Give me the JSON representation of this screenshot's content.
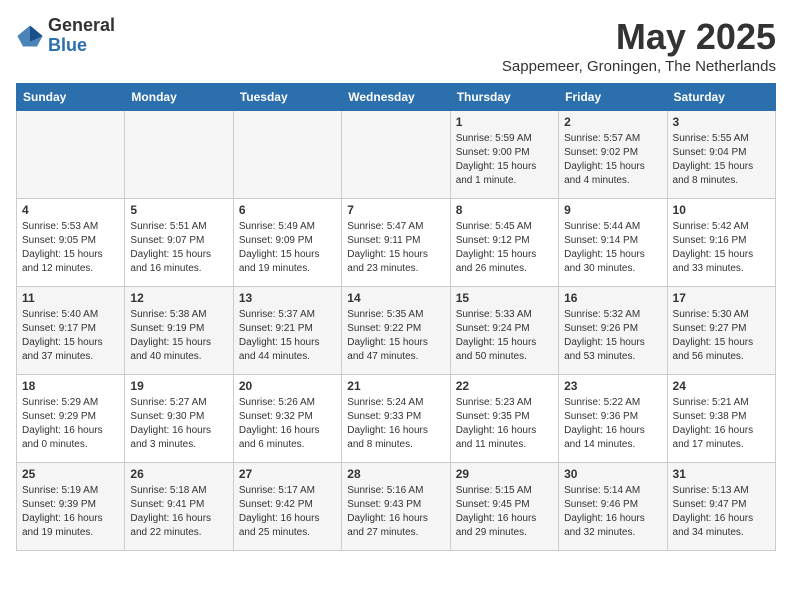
{
  "logo": {
    "general": "General",
    "blue": "Blue"
  },
  "title": "May 2025",
  "subtitle": "Sappemeer, Groningen, The Netherlands",
  "days_of_week": [
    "Sunday",
    "Monday",
    "Tuesday",
    "Wednesday",
    "Thursday",
    "Friday",
    "Saturday"
  ],
  "weeks": [
    [
      {
        "day": "",
        "info": ""
      },
      {
        "day": "",
        "info": ""
      },
      {
        "day": "",
        "info": ""
      },
      {
        "day": "",
        "info": ""
      },
      {
        "day": "1",
        "info": "Sunrise: 5:59 AM\nSunset: 9:00 PM\nDaylight: 15 hours\nand 1 minute."
      },
      {
        "day": "2",
        "info": "Sunrise: 5:57 AM\nSunset: 9:02 PM\nDaylight: 15 hours\nand 4 minutes."
      },
      {
        "day": "3",
        "info": "Sunrise: 5:55 AM\nSunset: 9:04 PM\nDaylight: 15 hours\nand 8 minutes."
      }
    ],
    [
      {
        "day": "4",
        "info": "Sunrise: 5:53 AM\nSunset: 9:05 PM\nDaylight: 15 hours\nand 12 minutes."
      },
      {
        "day": "5",
        "info": "Sunrise: 5:51 AM\nSunset: 9:07 PM\nDaylight: 15 hours\nand 16 minutes."
      },
      {
        "day": "6",
        "info": "Sunrise: 5:49 AM\nSunset: 9:09 PM\nDaylight: 15 hours\nand 19 minutes."
      },
      {
        "day": "7",
        "info": "Sunrise: 5:47 AM\nSunset: 9:11 PM\nDaylight: 15 hours\nand 23 minutes."
      },
      {
        "day": "8",
        "info": "Sunrise: 5:45 AM\nSunset: 9:12 PM\nDaylight: 15 hours\nand 26 minutes."
      },
      {
        "day": "9",
        "info": "Sunrise: 5:44 AM\nSunset: 9:14 PM\nDaylight: 15 hours\nand 30 minutes."
      },
      {
        "day": "10",
        "info": "Sunrise: 5:42 AM\nSunset: 9:16 PM\nDaylight: 15 hours\nand 33 minutes."
      }
    ],
    [
      {
        "day": "11",
        "info": "Sunrise: 5:40 AM\nSunset: 9:17 PM\nDaylight: 15 hours\nand 37 minutes."
      },
      {
        "day": "12",
        "info": "Sunrise: 5:38 AM\nSunset: 9:19 PM\nDaylight: 15 hours\nand 40 minutes."
      },
      {
        "day": "13",
        "info": "Sunrise: 5:37 AM\nSunset: 9:21 PM\nDaylight: 15 hours\nand 44 minutes."
      },
      {
        "day": "14",
        "info": "Sunrise: 5:35 AM\nSunset: 9:22 PM\nDaylight: 15 hours\nand 47 minutes."
      },
      {
        "day": "15",
        "info": "Sunrise: 5:33 AM\nSunset: 9:24 PM\nDaylight: 15 hours\nand 50 minutes."
      },
      {
        "day": "16",
        "info": "Sunrise: 5:32 AM\nSunset: 9:26 PM\nDaylight: 15 hours\nand 53 minutes."
      },
      {
        "day": "17",
        "info": "Sunrise: 5:30 AM\nSunset: 9:27 PM\nDaylight: 15 hours\nand 56 minutes."
      }
    ],
    [
      {
        "day": "18",
        "info": "Sunrise: 5:29 AM\nSunset: 9:29 PM\nDaylight: 16 hours\nand 0 minutes."
      },
      {
        "day": "19",
        "info": "Sunrise: 5:27 AM\nSunset: 9:30 PM\nDaylight: 16 hours\nand 3 minutes."
      },
      {
        "day": "20",
        "info": "Sunrise: 5:26 AM\nSunset: 9:32 PM\nDaylight: 16 hours\nand 6 minutes."
      },
      {
        "day": "21",
        "info": "Sunrise: 5:24 AM\nSunset: 9:33 PM\nDaylight: 16 hours\nand 8 minutes."
      },
      {
        "day": "22",
        "info": "Sunrise: 5:23 AM\nSunset: 9:35 PM\nDaylight: 16 hours\nand 11 minutes."
      },
      {
        "day": "23",
        "info": "Sunrise: 5:22 AM\nSunset: 9:36 PM\nDaylight: 16 hours\nand 14 minutes."
      },
      {
        "day": "24",
        "info": "Sunrise: 5:21 AM\nSunset: 9:38 PM\nDaylight: 16 hours\nand 17 minutes."
      }
    ],
    [
      {
        "day": "25",
        "info": "Sunrise: 5:19 AM\nSunset: 9:39 PM\nDaylight: 16 hours\nand 19 minutes."
      },
      {
        "day": "26",
        "info": "Sunrise: 5:18 AM\nSunset: 9:41 PM\nDaylight: 16 hours\nand 22 minutes."
      },
      {
        "day": "27",
        "info": "Sunrise: 5:17 AM\nSunset: 9:42 PM\nDaylight: 16 hours\nand 25 minutes."
      },
      {
        "day": "28",
        "info": "Sunrise: 5:16 AM\nSunset: 9:43 PM\nDaylight: 16 hours\nand 27 minutes."
      },
      {
        "day": "29",
        "info": "Sunrise: 5:15 AM\nSunset: 9:45 PM\nDaylight: 16 hours\nand 29 minutes."
      },
      {
        "day": "30",
        "info": "Sunrise: 5:14 AM\nSunset: 9:46 PM\nDaylight: 16 hours\nand 32 minutes."
      },
      {
        "day": "31",
        "info": "Sunrise: 5:13 AM\nSunset: 9:47 PM\nDaylight: 16 hours\nand 34 minutes."
      }
    ]
  ]
}
